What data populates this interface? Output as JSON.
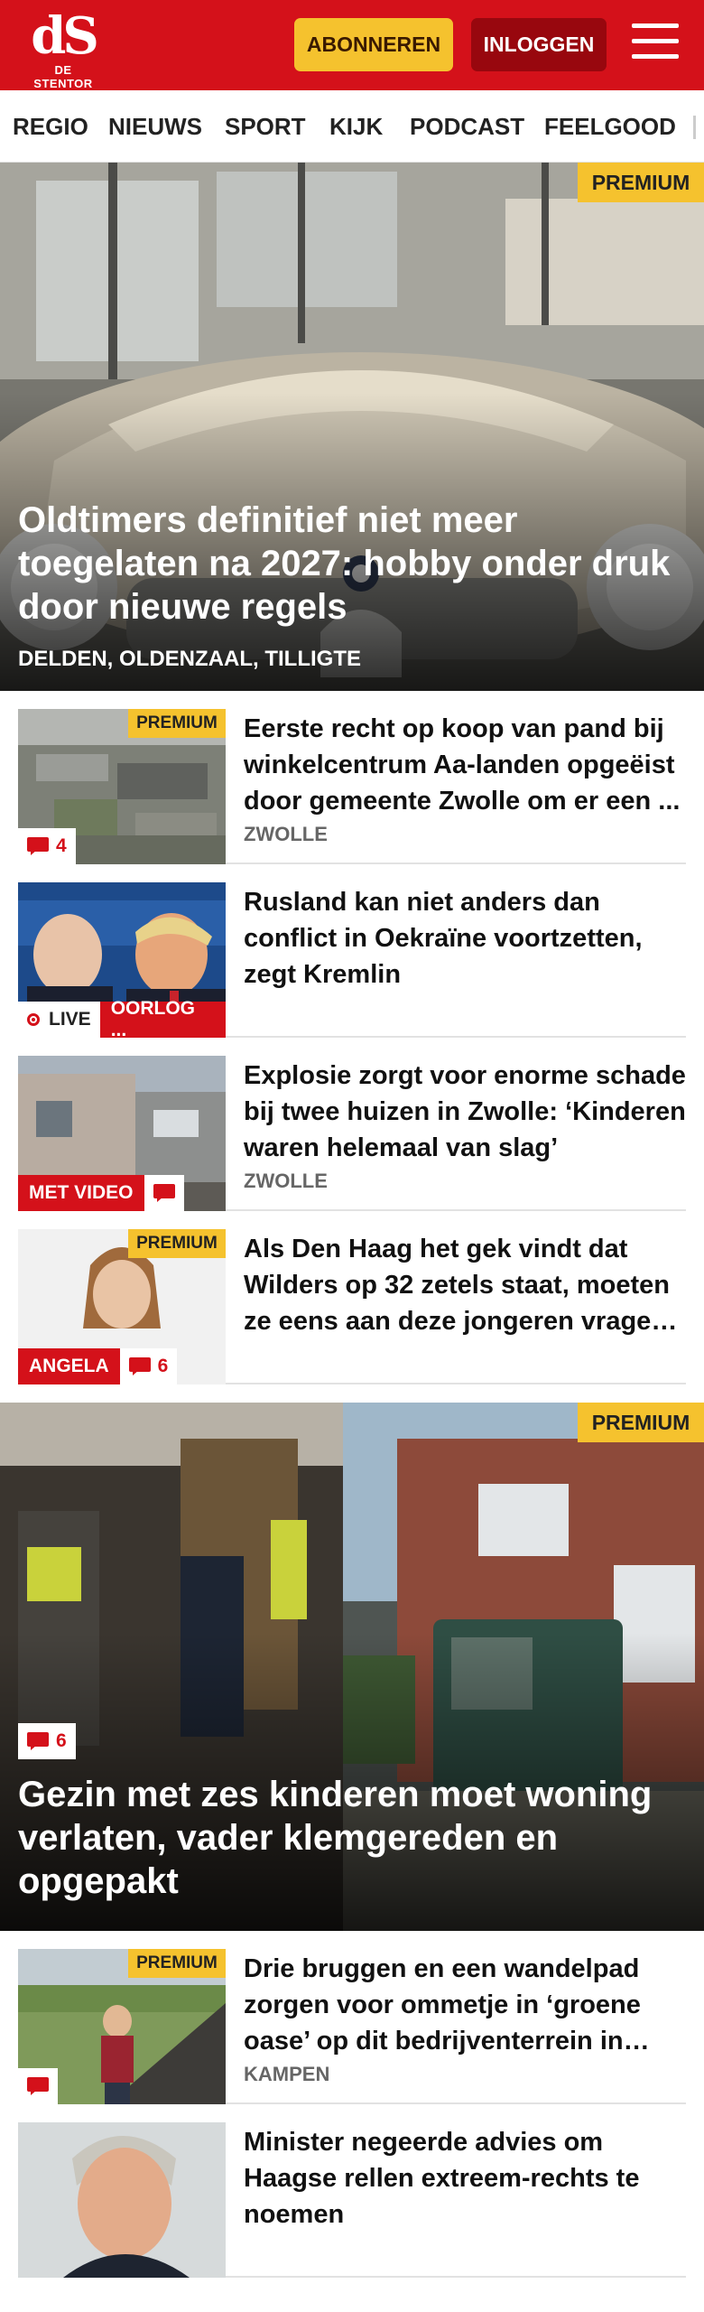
{
  "header": {
    "logo_mark": "dS",
    "logo_text": "DE STENTOR",
    "subscribe_label": "ABONNEREN",
    "login_label": "INLOGGEN",
    "menu_icon": "hamburger-icon"
  },
  "nav": {
    "items": [
      "REGIO",
      "NIEUWS",
      "SPORT",
      "KIJK",
      "PODCAST",
      "FEELGOOD"
    ]
  },
  "hero1": {
    "premium": "PREMIUM",
    "title": "Oldtimers definitief niet meer toegelaten na 2027: hobby onder druk door nieuwe regels",
    "meta": "DELDEN, OLDENZAAL, TILLIGTE"
  },
  "articles1": [
    {
      "title": "Eerste recht op koop van pand bij winkelcentrum Aa-landen opgeëist door gemeente Zwolle om er een ...",
      "location": "ZWOLLE",
      "premium": "PREMIUM",
      "comments": "4"
    },
    {
      "title": "Rusland kan niet anders dan conflict in Oekraïne voortzetten, zegt Kremlin",
      "live": "LIVE",
      "label": "OORLOG ..."
    },
    {
      "title": "Explosie zorgt voor enorme schade bij twee huizen in Zwolle: ‘Kinderen waren helemaal van slag’",
      "location": "ZWOLLE",
      "label": "MET VIDEO"
    },
    {
      "title": "Als Den Haag het gek vindt dat Wilders op 32 zetels staat, moeten ze eens aan deze jongeren vragen ...",
      "premium": "PREMIUM",
      "label": "ANGELA",
      "comments": "6"
    }
  ],
  "hero2": {
    "premium": "PREMIUM",
    "comments": "6",
    "title": "Gezin met zes kinderen moet woning verlaten, vader klemgereden en opgepakt"
  },
  "articles2": [
    {
      "title": "Drie bruggen en een wandelpad zorgen voor ommetje in ‘groene oase’ op dit bedrijventerrein in Kampen",
      "location": "KAMPEN",
      "premium": "PREMIUM"
    },
    {
      "title": "Minister negeerde advies om Haagse rellen extreem-rechts te noemen"
    }
  ],
  "colors": {
    "brand_red": "#d4111a",
    "premium_yellow": "#f5c22e",
    "login_dark_red": "#98070e"
  }
}
